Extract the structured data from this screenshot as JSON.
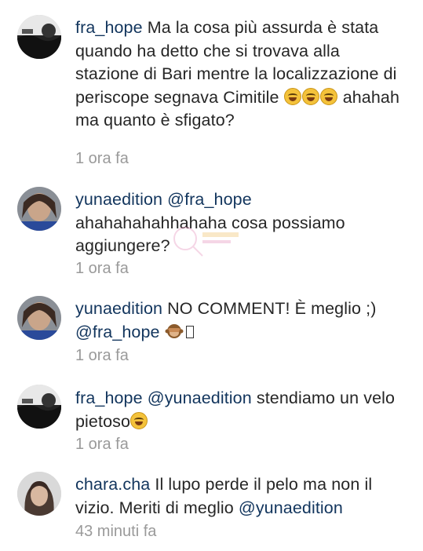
{
  "comments": [
    {
      "username": "fra_hope",
      "text_1": "Ma la cosa più assurda è stata quando ha detto che si trovava alla stazione di Bari mentre la localizzazione di periscope segnava Cimitile",
      "emojis": [
        "face-with-tears-of-joy",
        "face-with-tears-of-joy",
        "face-with-tears-of-joy"
      ],
      "text_2": "ahahah ma quanto è sfigato?",
      "timestamp": "1 ora fa"
    },
    {
      "username": "yunaedition",
      "mention": "@fra_hope",
      "text": "ahahahahahhahaha cosa possiamo aggiungere?",
      "timestamp": "1 ora fa"
    },
    {
      "username": "yunaedition",
      "text": "NO COMMENT! È meglio ;)",
      "mention": "@fra_hope",
      "emojis": [
        "see-no-evil-monkey",
        "missing-glyph"
      ],
      "timestamp": "1 ora fa"
    },
    {
      "username": "fra_hope",
      "mention": "@yunaedition",
      "text": "stendiamo un velo pietoso",
      "emojis": [
        "face-with-tears-of-joy"
      ],
      "timestamp": "1 ora fa"
    },
    {
      "username": "chara.cha",
      "text": "Il lupo perde il pelo ma non il vizio. Meriti di meglio",
      "mention": "@yunaedition",
      "timestamp": "43 minuti fa"
    }
  ],
  "colors": {
    "username": "#12355d",
    "text": "#262626",
    "timestamp": "#9a9a9a",
    "background": "#ffffff"
  }
}
